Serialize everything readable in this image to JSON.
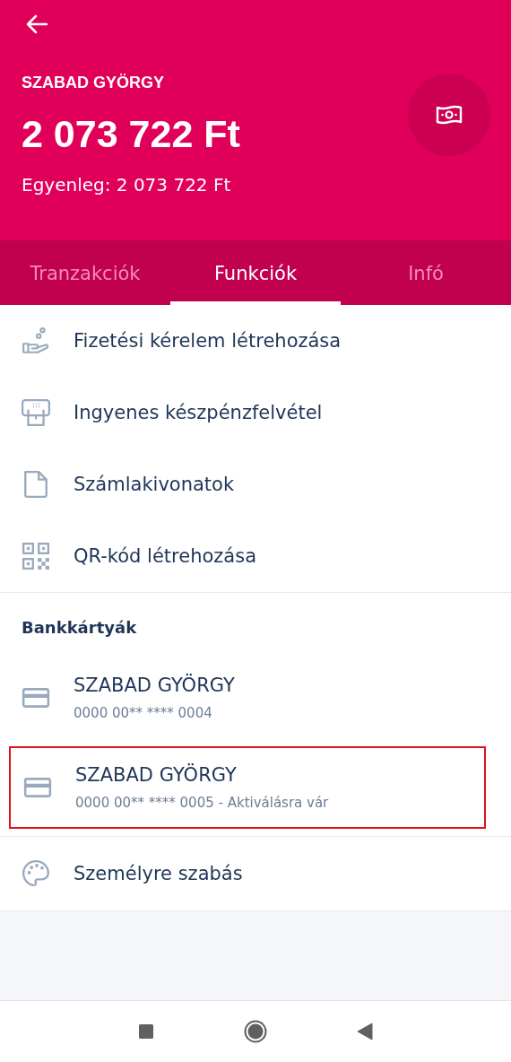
{
  "header": {
    "owner": "SZABAD GYÖRGY",
    "amount": "2 073 722 Ft",
    "balance": "Egyenleg: 2 073 722 Ft"
  },
  "tabs": [
    {
      "label": "Tranzakciók",
      "selected": false
    },
    {
      "label": "Funkciók",
      "selected": true
    },
    {
      "label": "Infó",
      "selected": false
    }
  ],
  "functions": [
    {
      "kind": "request",
      "label": "Fizetési kérelem létrehozása"
    },
    {
      "kind": "atm",
      "label": "Ingyenes készpénzfelvétel"
    },
    {
      "kind": "document",
      "label": "Számlakivonatok"
    },
    {
      "kind": "qr",
      "label": "QR-kód létrehozása"
    }
  ],
  "cards_section": {
    "title": "Bankkártyák",
    "cards": [
      {
        "name": "SZABAD GYÖRGY",
        "number": "0000 00** **** 0004",
        "highlighted": false
      },
      {
        "name": "SZABAD GYÖRGY",
        "number": "0000 00** **** 0005 - Aktiválásra vár",
        "highlighted": true
      }
    ]
  },
  "personalize": {
    "label": "Személyre szabás"
  }
}
